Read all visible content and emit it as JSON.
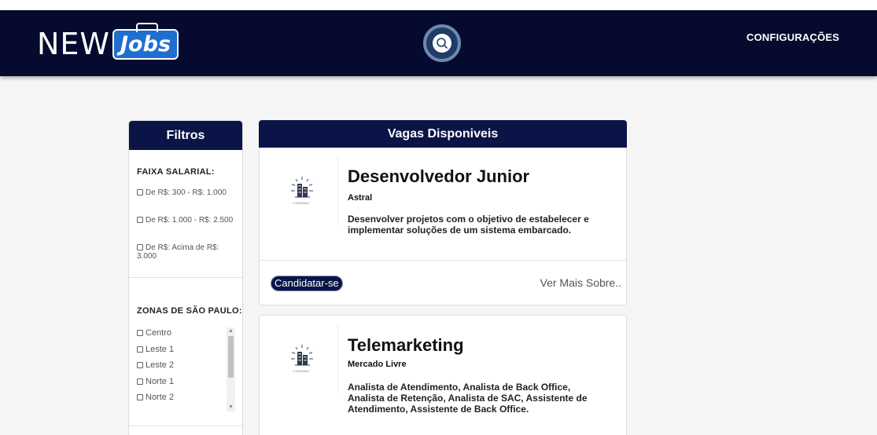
{
  "header": {
    "logo_text_new": "NEW",
    "logo_text_jobs": "Jobs",
    "search_icon": "search-icon",
    "settings_label": "CONFIGURAÇÕES"
  },
  "filters": {
    "title": "Filtros",
    "salary": {
      "title": "FAIXA SALARIAL:",
      "options": [
        "De R$: 300 - R$: 1.000",
        "De R$: 1.000 - R$: 2.500",
        "De R$: Acima de R$: 3.000"
      ]
    },
    "zones": {
      "title": "ZONAS DE SÃO PAULO:",
      "options": [
        "Centro",
        "Leste 1",
        "Leste 2",
        "Norte 1",
        "Norte 2"
      ]
    }
  },
  "jobs": {
    "title": "Vagas Disponiveis",
    "logo_caption": "COMPANY",
    "apply_label": "Candidatar-se",
    "more_label": "Ver Mais Sobre..",
    "items": [
      {
        "title": "Desenvolvedor Junior",
        "company": "Astral",
        "description": "Desenvolver projetos com o objetivo de estabelecer e implementar soluções de um sistema embarcado."
      },
      {
        "title": "Telemarketing",
        "company": "Mercado Livre",
        "description": "Analista de Atendimento, Analista de Back Office, Analista de Retenção, Analista de SAC, Assistente de Atendimento, Assistente de Back Office."
      }
    ]
  },
  "colors": {
    "header_bg": "#060a2e",
    "panel_header_bg": "#0a1446",
    "page_bg": "#f5f5f5"
  }
}
